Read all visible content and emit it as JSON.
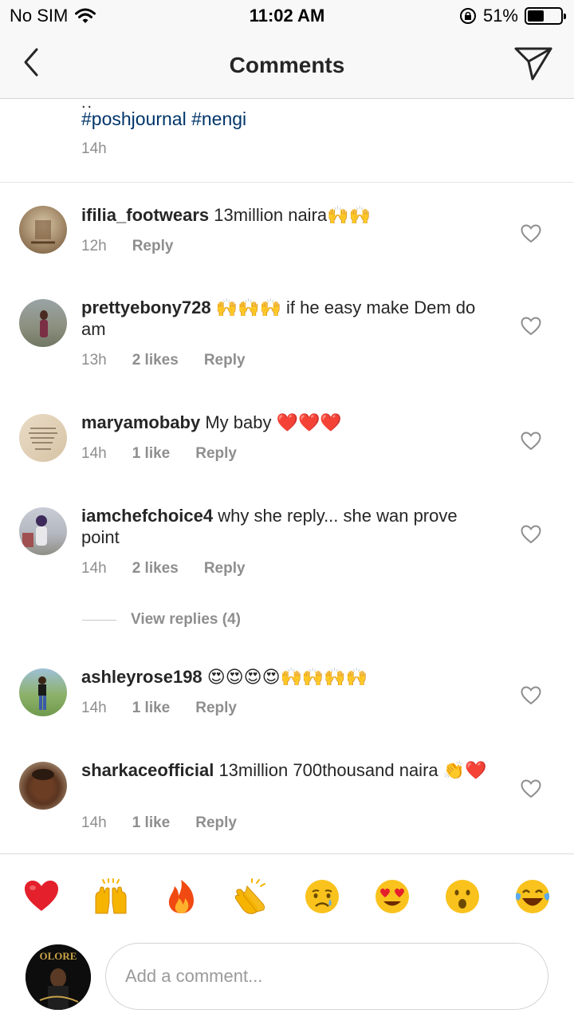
{
  "status_bar": {
    "carrier": "No SIM",
    "time": "11:02 AM",
    "battery": "51%",
    "battery_level": 0.51,
    "icons": [
      "wifi-icon",
      "orientation-lock-icon",
      "battery-icon"
    ]
  },
  "header": {
    "title": "Comments",
    "back_icon": "chevron-left-icon",
    "share_icon": "paper-plane-icon"
  },
  "caption": {
    "ellipsis": "..",
    "hashtags": "#poshjournal #nengi",
    "time": "14h"
  },
  "comments": [
    {
      "username": "ifilia_footwears",
      "text": "13million naira🙌🙌",
      "time": "12h",
      "likes": "",
      "reply": "Reply"
    },
    {
      "username": "prettyebony728",
      "text": "🙌🙌🙌 if he easy make Dem do am",
      "time": "13h",
      "likes": "2 likes",
      "reply": "Reply"
    },
    {
      "username": "maryamobaby",
      "text": "My baby ❤️❤️❤️",
      "time": "14h",
      "likes": "1 like",
      "reply": "Reply"
    },
    {
      "username": "iamchefchoice4",
      "text": "why she reply... she wan prove point",
      "time": "14h",
      "likes": "2 likes",
      "reply": "Reply"
    },
    {
      "username": "ashleyrose198",
      "text": "😍😍😍😍🙌🙌🙌🙌",
      "time": "14h",
      "likes": "1 like",
      "reply": "Reply"
    },
    {
      "username": "sharkaceofficial",
      "text": "13million 700thousand naira 👏❤️",
      "time": "14h",
      "likes": "1 like",
      "reply": "Reply"
    }
  ],
  "view_replies": "View replies (4)",
  "quick_reactions": [
    "❤️",
    "🙌",
    "🔥",
    "👏",
    "😢",
    "😍",
    "😮",
    "😂"
  ],
  "composer": {
    "placeholder": "Add a comment...",
    "avatar_text": "OLORE"
  },
  "colors": {
    "hashtag": "#003569",
    "secondary_text": "#8e8e8e",
    "primary_text": "#262626"
  }
}
